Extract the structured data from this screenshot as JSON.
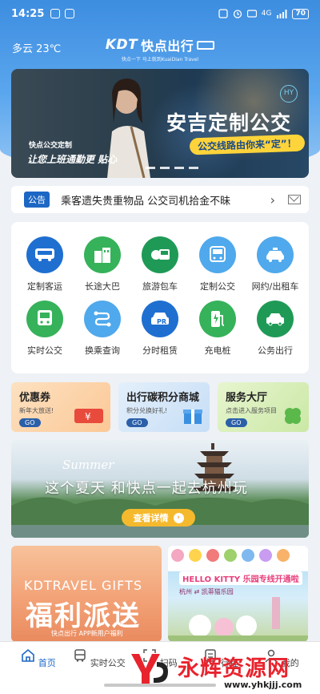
{
  "status_bar": {
    "time": "14:25",
    "battery": "70",
    "signal_label": "4G"
  },
  "header": {
    "weather": "多云 23℃",
    "logo_kdt": "KDT",
    "logo_cn": "快点出行",
    "logo_sub": "快点一下 马上就到KuaiDian Travel"
  },
  "hero": {
    "title": "安吉定制公交",
    "slogan": "公交线路由你来“定”！",
    "left_tag": "快点公交定制",
    "left_sub": "让您上班通勤更 贴心",
    "badge": "HY"
  },
  "notice": {
    "tag": "公告",
    "text": "乘客遗失贵重物品 公交司机拾金不昧"
  },
  "services": [
    {
      "label": "定制客运",
      "icon": "custom-coach-icon",
      "color": "#1f6fd1"
    },
    {
      "label": "长途大巴",
      "icon": "long-distance-bus-icon",
      "color": "#36b25a"
    },
    {
      "label": "旅游包车",
      "icon": "tour-bus-icon",
      "color": "#1f9a56"
    },
    {
      "label": "定制公交",
      "icon": "custom-bus-icon",
      "color": "#4fa9ec"
    },
    {
      "label": "网约/出租车",
      "icon": "taxi-icon",
      "color": "#4fa9ec"
    },
    {
      "label": "实时公交",
      "icon": "realtime-bus-icon",
      "color": "#36b25a"
    },
    {
      "label": "换乘查询",
      "icon": "transfer-route-icon",
      "color": "#4fa9ec"
    },
    {
      "label": "分时租赁",
      "icon": "car-rental-icon",
      "color": "#1f6fd1"
    },
    {
      "label": "充电桩",
      "icon": "charging-pile-icon",
      "color": "#36b25a"
    },
    {
      "label": "公务出行",
      "icon": "official-car-icon",
      "color": "#1f9a56"
    }
  ],
  "promos": [
    {
      "title": "优惠券",
      "sub": "新年大放送!",
      "go": "GO",
      "color": "#fcd4aa"
    },
    {
      "title": "出行碳积分商城",
      "sub": "积分兑换好礼!",
      "go": "GO",
      "color": "#cfe3f8"
    },
    {
      "title": "服务大厅",
      "sub": "点击进入服务项目",
      "go": "GO",
      "color": "#d8efb9"
    }
  ],
  "hangzhou_banner": {
    "summer": "Summer",
    "title": "这个夏天 和快点一起去杭州玩",
    "button": "查看详情"
  },
  "gift_card": {
    "en": "KDTRAVEL GIFTS",
    "cn": "福利派送",
    "sub": "快点出行 APP新用户福利"
  },
  "kitty_card": {
    "title": "HELLO KITTY 乐园专线开通啦",
    "sub": "杭州 ⇄ 凯蒂猫乐园"
  },
  "bottom_nav": [
    {
      "label": "首页",
      "icon": "home-icon",
      "active": true
    },
    {
      "label": "实时公交",
      "icon": "bus-icon",
      "active": false
    },
    {
      "label": "扫码",
      "icon": "scan-icon",
      "active": false
    },
    {
      "label": "行程",
      "icon": "trip-icon",
      "active": false
    },
    {
      "label": "我的",
      "icon": "profile-icon",
      "active": false
    }
  ],
  "watermark": {
    "text": "永辉资源网",
    "url": "www.yhkjjj.com"
  }
}
